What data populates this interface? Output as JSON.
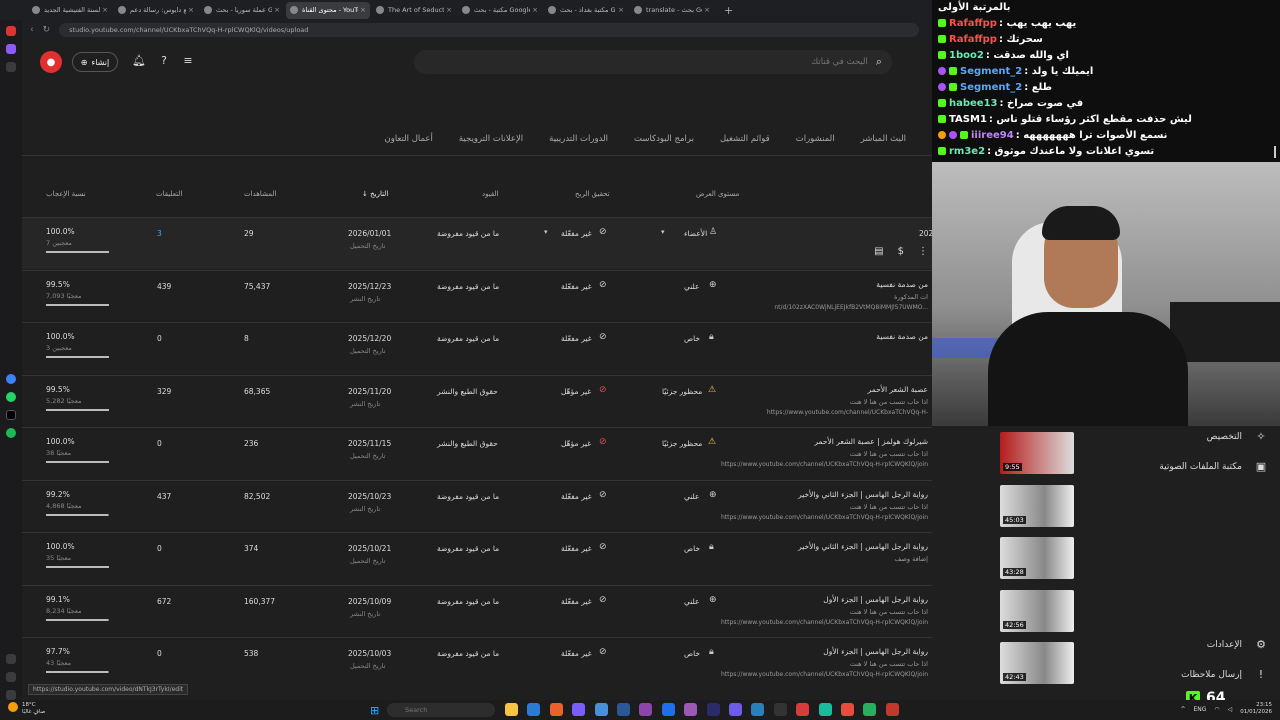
{
  "browser": {
    "tabs": [
      {
        "label": "رأس السنة الفتيشية الجديد",
        "active": false
      },
      {
        "label": "كتنا مع دايوس: رسالة دعم",
        "active": false
      },
      {
        "label": "عملة سوريا - بحث Google",
        "active": false
      },
      {
        "label": "محتوى القناة - YouTube Studio",
        "active": true
      },
      {
        "label": "The Art of Seduction by R",
        "active": false
      },
      {
        "label": "مكتبة - بحث Google",
        "active": false
      },
      {
        "label": "مكتبة بغداد - بحث Google",
        "active": false
      },
      {
        "label": "translate - بحث Google",
        "active": false
      }
    ],
    "new_tab": "+",
    "url": "studio.youtube.com/channel/UCKbxaTChVQq-H-rplCWQKlQ/videos/upload",
    "status_url": "https://studio.youtube.com/video/dNTkJ3rTykI/edit"
  },
  "studio": {
    "create_label": "إنشاء",
    "search_placeholder": "البحث في قناتك",
    "tabs": [
      "البث المباشر",
      "المنشورات",
      "قوائم التشغيل",
      "برامج البودكاست",
      "الدورات التدريبية",
      "الإعلانات الترويجية",
      "أعمال التعاون"
    ],
    "columns": {
      "visibility": "مستوى العرض",
      "monetization": "تحقيق الربح",
      "restrictions": "القيود",
      "date": "التاريخ",
      "views": "المشاهدات",
      "comments": "التعليقات",
      "likes": "نسبة الإعجاب"
    },
    "rows": [
      {
        "title": "",
        "desc": "",
        "visibility": "الأعضاء",
        "monetization": "غير مفعّلة",
        "restrictions": "ما من قيود مفروضة",
        "date": "2026/01/01",
        "date_type": "تاريخ التحميل",
        "views": "29",
        "comments": "3",
        "likes": "100.0%",
        "likes_sub": "7 معجبين",
        "like_pct": 100,
        "cut_date": "202"
      },
      {
        "title": "من صدمة نفسية",
        "desc": "nt/d/102zXAC0WjNLjEEJkfB2VtMQ8iMMJlS7UWMO...",
        "desc2": "ات المذكورة",
        "visibility": "علني",
        "monetization": "غير مفعّلة",
        "restrictions": "ما من قيود مفروضة",
        "date": "2025/12/23",
        "date_type": "تاريخ النشر",
        "views": "75,437",
        "comments": "439",
        "likes": "99.5%",
        "likes_sub": "7,093 معجبًا",
        "like_pct": 99.5
      },
      {
        "title": "من صدمة نفسية",
        "desc": "",
        "visibility": "خاص",
        "monetization": "غير مفعّلة",
        "restrictions": "ما من قيود مفروضة",
        "date": "2025/12/20",
        "date_type": "تاريخ التحميل",
        "views": "8",
        "comments": "0",
        "likes": "100.0%",
        "likes_sub": "3 معجبين",
        "like_pct": 100
      },
      {
        "title": "عصبة الشعر الأحمر",
        "desc": "https://www.youtube.com/channel/UCKbxaTChVQq-H-",
        "desc2": "اذا حاب تتسب من هنا لا هنت",
        "visibility": "محظور جزئيًا",
        "monetization": "غير مؤهّل",
        "restrictions": "حقوق الطبع والنشر",
        "date": "2025/11/20",
        "date_type": "تاريخ النشر",
        "views": "68,365",
        "comments": "329",
        "likes": "99.5%",
        "likes_sub": "5,282 معجبًا",
        "like_pct": 99.5
      },
      {
        "title": "شيرلوك هولمز | عصبة الشعر الأحمر",
        "desc": "https://www.youtube.com/channel/UCKbxaTChVQq-H-rplCWQKlQ/join",
        "desc2": "اذا حاب تتسب من هنا لا هنت",
        "visibility": "محظور جزئيًا",
        "monetization": "غير مؤهّل",
        "restrictions": "حقوق الطبع والنشر",
        "date": "2025/11/15",
        "date_type": "تاريخ التحميل",
        "views": "236",
        "comments": "0",
        "likes": "100.0%",
        "likes_sub": "38 معجبًا",
        "like_pct": 100,
        "thumb": "red",
        "duration": "9:55"
      },
      {
        "title": "رواية الرجل الهامس | الجزء الثاني والأخير",
        "desc": "https://www.youtube.com/channel/UCKbxaTChVQq-H-rplCWQKlQ/join",
        "desc2": "اذا حاب تتسب من هنا لا هنت",
        "visibility": "علني",
        "monetization": "غير مفعّلة",
        "restrictions": "ما من قيود مفروضة",
        "date": "2025/10/23",
        "date_type": "تاريخ النشر",
        "views": "82,502",
        "comments": "437",
        "likes": "99.2%",
        "likes_sub": "4,868 معجبًا",
        "like_pct": 99.2,
        "thumb": "bw",
        "duration": "45:03"
      },
      {
        "title": "رواية الرجل الهامس | الجزء الثاني والأخير",
        "desc": "",
        "desc2": "إضافة وصف",
        "visibility": "خاص",
        "monetization": "غير مفعّلة",
        "restrictions": "ما من قيود مفروضة",
        "date": "2025/10/21",
        "date_type": "تاريخ التحميل",
        "views": "374",
        "comments": "0",
        "likes": "100.0%",
        "likes_sub": "35 معجبًا",
        "like_pct": 100,
        "thumb": "bw",
        "duration": "43:28"
      },
      {
        "title": "رواية الرجل الهامس | الجزء الأول",
        "desc": "https://www.youtube.com/channel/UCKbxaTChVQq-H-rplCWQKlQ/join",
        "desc2": "اذا حاب تتسب من هنا لا هنت",
        "visibility": "علني",
        "monetization": "غير مفعّلة",
        "restrictions": "ما من قيود مفروضة",
        "date": "2025/10/09",
        "date_type": "تاريخ النشر",
        "views": "160,377",
        "comments": "672",
        "likes": "99.1%",
        "likes_sub": "8,234 معجبًا",
        "like_pct": 99.1,
        "thumb": "bw",
        "duration": "42:56"
      },
      {
        "title": "رواية الرجل الهامس | الجزء الأول",
        "desc": "https://www.youtube.com/channel/UCKbxaTChVQq-H-rplCWQKlQ/join",
        "desc2": "اذا حاب تتسب من هنا لا هنت",
        "visibility": "خاص",
        "monetization": "غير مفعّلة",
        "restrictions": "ما من قيود مفروضة",
        "date": "2025/10/03",
        "date_type": "تاريخ التحميل",
        "views": "538",
        "comments": "0",
        "likes": "97.7%",
        "likes_sub": "43 معجبًا",
        "like_pct": 97.7,
        "thumb": "bw",
        "duration": "42:43"
      }
    ]
  },
  "side_menu": {
    "customize": "التخصيص",
    "audio_library": "مكتبة الملفات الصوتية",
    "settings": "الإعدادات",
    "feedback": "إرسال ملاحظات"
  },
  "chat": [
    {
      "user": "",
      "msg": "بالمرتبة الأولى",
      "color": "#ffffff",
      "badges": []
    },
    {
      "user": "Rafaffpp",
      "msg": "يهب يهب يهب",
      "color": "#ff4d4d",
      "badges": [
        "kick"
      ]
    },
    {
      "user": "Rafaffpp",
      "msg": "سحرتك",
      "color": "#ff4d4d",
      "badges": [
        "kick"
      ]
    },
    {
      "user": "1boo2",
      "msg": "اي والله صدقت",
      "color": "#6ee7b7",
      "badges": [
        "kick"
      ]
    },
    {
      "user": "Segment_2",
      "msg": "ايميلك يا ولد",
      "color": "#60a5fa",
      "badges": [
        "circ",
        "kick"
      ]
    },
    {
      "user": "Segment_2",
      "msg": "طلع",
      "color": "#60a5fa",
      "badges": [
        "circ",
        "kick"
      ]
    },
    {
      "user": "habee13",
      "msg": "في صوت صراخ",
      "color": "#6ee7b7",
      "badges": [
        "kick"
      ]
    },
    {
      "user": "TASM1",
      "msg": "ليش حذفت مقطع اكثر رؤساء قتلو ناس",
      "color": "#ffffff",
      "badges": [
        "kick"
      ]
    },
    {
      "user": "iiiree94",
      "msg": "نسمع الأصوات ترا هههههههه",
      "color": "#c084fc",
      "badges": [
        "gold",
        "circ",
        "kick"
      ]
    },
    {
      "user": "rm3e2",
      "msg": "تسوي اعلانات ولا ماعندك موثوق",
      "color": "#6ee7b7",
      "badges": [
        "kick"
      ]
    }
  ],
  "viewer_count": "64",
  "taskbar": {
    "weather_temp": "18°C",
    "weather_desc": "صافٍ غالبًا",
    "search_label": "Search",
    "lang": "ENG",
    "time": "23:15",
    "date": "01/01/2026"
  },
  "colors": {
    "accent": "#3ea6ff",
    "brand_red": "#e03030",
    "kick_green": "#53fc18"
  }
}
